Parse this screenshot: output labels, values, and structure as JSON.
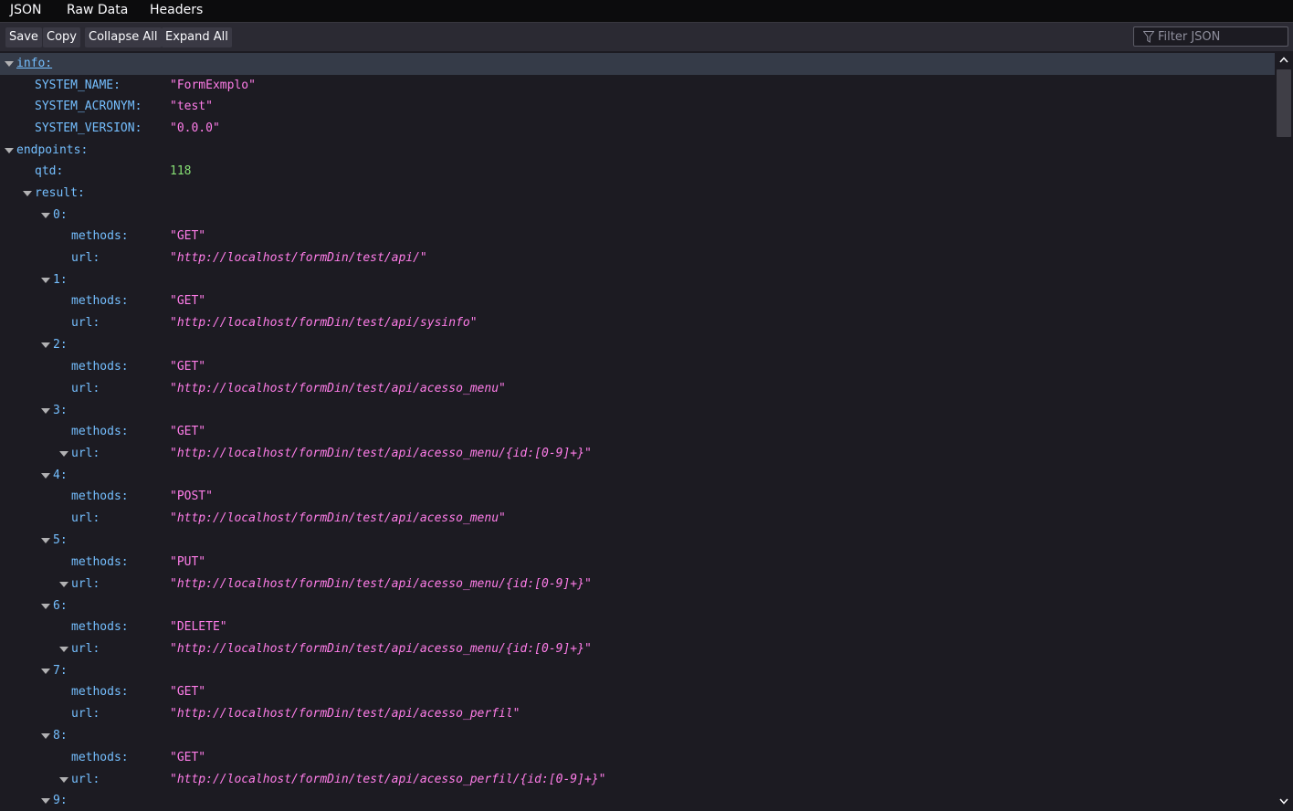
{
  "tabs": [
    "JSON",
    "Raw Data",
    "Headers"
  ],
  "toolbar": {
    "save": "Save",
    "copy": "Copy",
    "collapse_all": "Collapse All",
    "expand_all": "Expand All",
    "filter_placeholder": "Filter JSON"
  },
  "icons": {
    "filter": "filter-icon",
    "twisty": "triangle-down-icon",
    "scroll_up": "scroll-up-arrow-icon",
    "scroll_down": "scroll-down-arrow-icon"
  },
  "colors": {
    "key": "#75bfff",
    "string": "#ff7de9",
    "number": "#86de74",
    "background": "#1c1b22",
    "selected_row": "#353b48"
  },
  "tree": {
    "info_key": "info:",
    "system_name_key": "SYSTEM_NAME:",
    "system_name_val": "\"FormExmplo\"",
    "system_acronym_key": "SYSTEM_ACRONYM:",
    "system_acronym_val": "\"test\"",
    "system_version_key": "SYSTEM_VERSION:",
    "system_version_val": "\"0.0.0\"",
    "endpoints_key": "endpoints:",
    "qtd_key": "qtd:",
    "qtd_val": "118",
    "result_key": "result:",
    "methods_key": "methods:",
    "url_key": "url:",
    "items": [
      {
        "index": "0:",
        "method": "\"GET\"",
        "url": "\"http://localhost/formDin/test/api/\""
      },
      {
        "index": "1:",
        "method": "\"GET\"",
        "url": "\"http://localhost/formDin/test/api/sysinfo\""
      },
      {
        "index": "2:",
        "method": "\"GET\"",
        "url": "\"http://localhost/formDin/test/api/acesso_menu\""
      },
      {
        "index": "3:",
        "method": "\"GET\"",
        "url": "\"http://localhost/formDin/test/api/acesso_menu/{id:[0-9]+}\""
      },
      {
        "index": "4:",
        "method": "\"POST\"",
        "url": "\"http://localhost/formDin/test/api/acesso_menu\""
      },
      {
        "index": "5:",
        "method": "\"PUT\"",
        "url": "\"http://localhost/formDin/test/api/acesso_menu/{id:[0-9]+}\""
      },
      {
        "index": "6:",
        "method": "\"DELETE\"",
        "url": "\"http://localhost/formDin/test/api/acesso_menu/{id:[0-9]+}\""
      },
      {
        "index": "7:",
        "method": "\"GET\"",
        "url": "\"http://localhost/formDin/test/api/acesso_perfil\""
      },
      {
        "index": "8:",
        "method": "\"GET\"",
        "url": "\"http://localhost/formDin/test/api/acesso_perfil/{id:[0-9]+}\""
      },
      {
        "index": "9:"
      }
    ]
  }
}
